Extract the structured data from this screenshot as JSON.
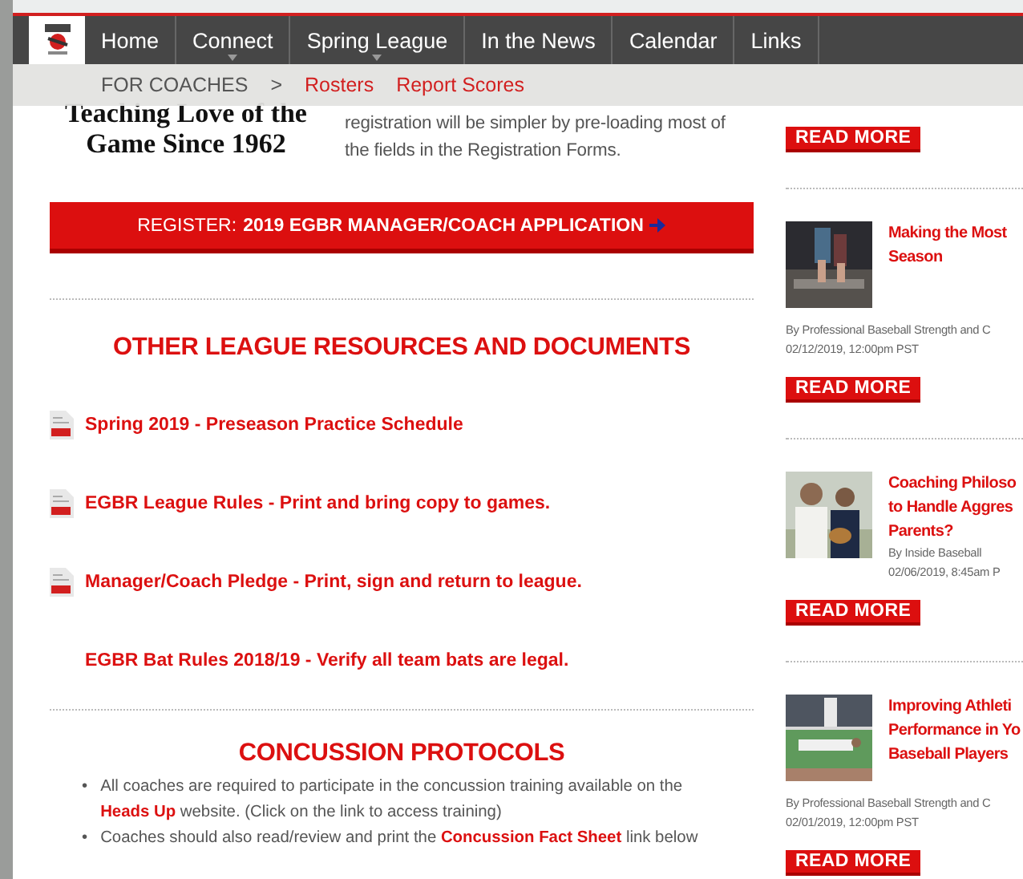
{
  "nav": {
    "items": [
      {
        "label": "Home",
        "has_dropdown": false
      },
      {
        "label": "Connect",
        "has_dropdown": true
      },
      {
        "label": "Spring League",
        "has_dropdown": true
      },
      {
        "label": "In the News",
        "has_dropdown": false
      },
      {
        "label": "Calendar",
        "has_dropdown": false
      },
      {
        "label": "Links",
        "has_dropdown": false
      }
    ]
  },
  "subnav": {
    "section": "FOR COACHES",
    "separator": ">",
    "links": [
      "Rosters",
      "Report Scores"
    ]
  },
  "tagline": [
    "Teaching Love of the",
    "Game Since 1962"
  ],
  "intro": "registration will be simpler by pre-loading most of the fields in the Registration Forms.",
  "register_button": {
    "prefix": "REGISTER:",
    "label": "2019 EGBR MANAGER/COACH APPLICATION"
  },
  "resources": {
    "title": "OTHER LEAGUE RESOURCES AND DOCUMENTS",
    "documents": [
      {
        "kind": "pdf",
        "label": "Spring 2019 - Preseason Practice Schedule"
      },
      {
        "kind": "pdf",
        "label": "EGBR League Rules - Print and bring copy to games."
      },
      {
        "kind": "pdf",
        "label": "Manager/Coach Pledge - Print, sign and return to league."
      },
      {
        "kind": "link",
        "label": "EGBR Bat Rules 2018/19 - Verify all team bats are legal."
      }
    ]
  },
  "concussion": {
    "title": "CONCUSSION PROTOCOLS",
    "marker": "•",
    "bullets": [
      [
        {
          "kind": "text",
          "text": "All coaches are required to participate in the concussion training available on the "
        },
        {
          "kind": "link",
          "text": "Heads Up"
        },
        {
          "kind": "text",
          "text": " website. (Click on the link to access training)"
        }
      ],
      [
        {
          "kind": "text",
          "text": "Coaches should also read/review and print the "
        },
        {
          "kind": "link",
          "text": "Concussion Fact Sheet"
        },
        {
          "kind": "text",
          "text": " link below"
        }
      ]
    ]
  },
  "articles": [
    {
      "kind": "partial",
      "button": "READ MORE"
    },
    {
      "kind": "full",
      "title_lines": [
        "Making the Most",
        "Season"
      ],
      "byline": "By Professional Baseball Strength and C",
      "date": "02/12/2019, 12:00pm PST",
      "button": "READ MORE",
      "picture": {
        "kind": "picture"
      }
    },
    {
      "kind": "full",
      "title_lines": [
        "Coaching Philoso",
        "to Handle Aggres",
        "Parents?"
      ],
      "byline": "By Inside Baseball",
      "date": "02/06/2019, 8:45am P",
      "button": "READ MORE",
      "picture": {
        "kind": "picture"
      }
    },
    {
      "kind": "full",
      "title_lines": [
        "Improving Athleti",
        "Performance in Yo",
        "Baseball Players"
      ],
      "byline": "By Professional Baseball Strength and C",
      "date": "02/01/2019, 12:00pm PST",
      "button": "READ MORE",
      "picture": {
        "kind": "picture"
      }
    }
  ]
}
